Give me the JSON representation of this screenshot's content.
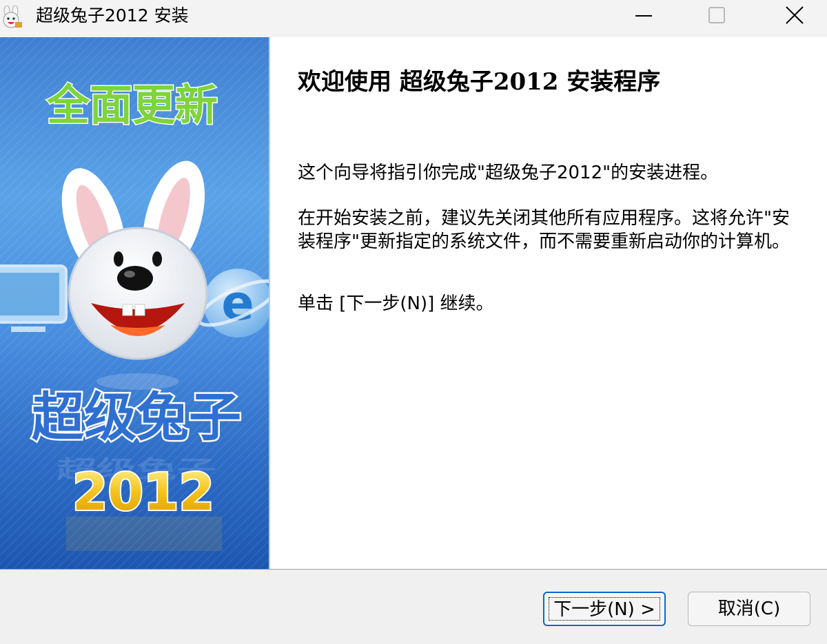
{
  "window": {
    "title": "超级兔子2012 安装",
    "icon": "rabbit-app-icon",
    "controls": {
      "minimize_icon": "minimize-icon",
      "maximize_icon": "maximize-icon",
      "close_icon": "close-icon"
    }
  },
  "banner": {
    "top_text": "全面更新",
    "brand_text": "超级兔子",
    "year_text": "2012",
    "mascot": "rabbit-mascot-icon",
    "side_icons": [
      "monitor-icon",
      "ie-browser-icon"
    ],
    "colors": {
      "top_text": "#7ed43a",
      "brand_text": "#2f6fd1",
      "year_text": "#f5c21a"
    }
  },
  "content": {
    "heading": "欢迎使用 超级兔子2012 安装程序",
    "paragraph1": "这个向导将指引你完成\"超级兔子2012\"的安装进程。",
    "paragraph2": "在开始安装之前，建议先关闭其他所有应用程序。这将允许\"安装程序\"更新指定的系统文件，而不需要重新启动你的计算机。",
    "paragraph3": "单击 [下一步(N)] 继续。"
  },
  "buttons": {
    "next": "下一步(N) >",
    "cancel": "取消(C)"
  },
  "colors": {
    "accent": "#0a64c8",
    "titlebar": "#f3f3f3",
    "footer": "#f0f0f0"
  }
}
